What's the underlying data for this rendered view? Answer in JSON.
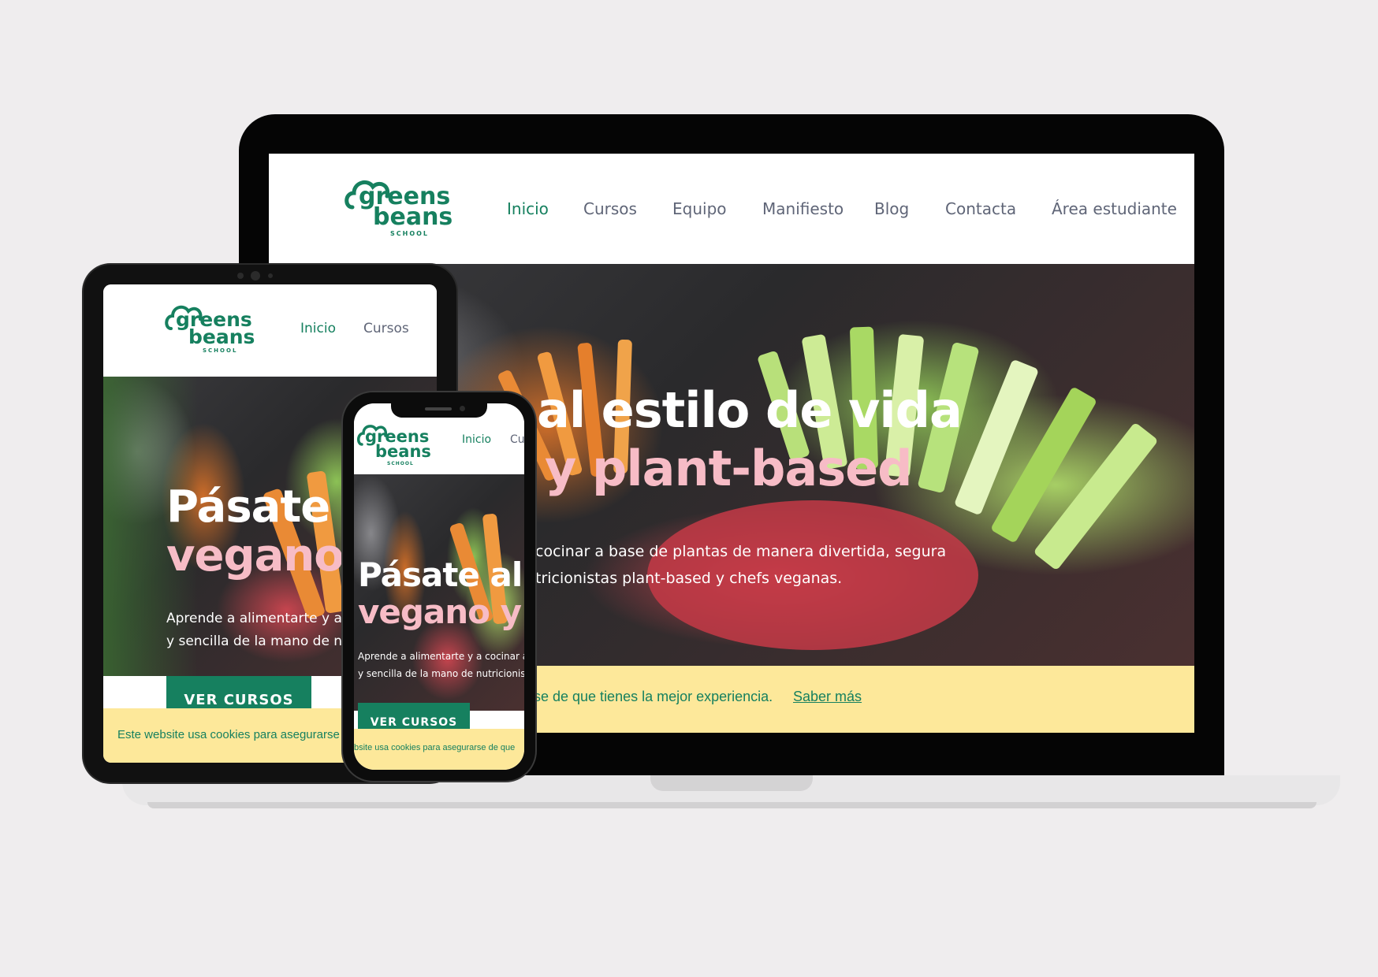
{
  "brand": {
    "logo_line1": "greens",
    "logo_line2": "beans",
    "logo_tag": "SCHOOL"
  },
  "nav": {
    "items": [
      "Inicio",
      "Cursos",
      "Equipo",
      "Manifiesto",
      "Blog",
      "Contacta",
      "Área estudiante"
    ]
  },
  "desktop": {
    "hero_line1": "al estilo de vida",
    "hero_line2": "y plant-based",
    "hero_sub1": "cocinar a base de plantas  de manera divertida, segura",
    "hero_sub2": "tricionistas plant-based y chefs veganas.",
    "cookie_text": "rse de que tienes la mejor experiencia.",
    "cookie_link": "Saber más"
  },
  "tablet": {
    "hero_line1": "Pásate a",
    "hero_line2": "vegano y",
    "hero_sub1": "Aprende a alimentarte y a coc",
    "hero_sub2": "y sencilla de la mano de nutric",
    "button": "VER CURSOS",
    "cookie_text": "Este website usa cookies para asegurarse"
  },
  "phone": {
    "nav_item1": "Inicio",
    "nav_item2": "Cu",
    "hero_line1": "Pásate al e",
    "hero_line2": "vegano y p",
    "hero_sub1": "Aprende a alimentarte y a cocinar a l",
    "hero_sub2": "y sencilla de la mano de nutricionista",
    "button": "VER CURSOS",
    "cookie_text": "bsite usa cookies para asegurarse de que"
  },
  "colors": {
    "brand_green": "#16805f",
    "pink": "#f7bcc6",
    "cookie_bg": "#fde89a",
    "nav_gray": "#5f6577"
  }
}
